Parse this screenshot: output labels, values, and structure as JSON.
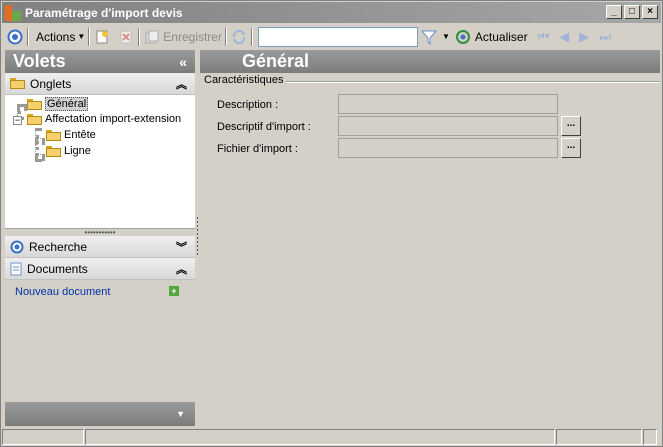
{
  "window": {
    "title": "Paramétrage d'import devis",
    "controls": {
      "minimize": "_",
      "maximize": "□",
      "close": "×"
    }
  },
  "toolbar": {
    "actions_label": "Actions",
    "save_label": "Enregistrer",
    "search_value": "",
    "refresh_label": "Actualiser",
    "icons": [
      "circle-icon",
      "new-doc-icon",
      "delete-icon",
      "save-icon",
      "sync-icon",
      "filter-icon",
      "refresh-icon",
      "first-icon",
      "prev-icon",
      "next-icon",
      "last-icon"
    ]
  },
  "left_panel": {
    "title": "Volets",
    "collapse": "«",
    "sections": {
      "onglets": {
        "label": "Onglets",
        "chevron": "⌃"
      },
      "recherche": {
        "label": "Recherche",
        "chevron": "⌄"
      },
      "documents": {
        "label": "Documents",
        "chevron": "⌃"
      }
    },
    "tree": {
      "general": "Général",
      "affectation": "Affectation import-extension",
      "entete": "Entête",
      "ligne": "Ligne"
    },
    "new_document": "Nouveau document"
  },
  "main": {
    "header": "Général",
    "group_title": "Caractéristiques",
    "fields": {
      "description": {
        "label": "Description :",
        "value": ""
      },
      "descriptif_import": {
        "label": "Descriptif d'import :",
        "value": "",
        "button": "..."
      },
      "fichier_import": {
        "label": "Fichier d'import :",
        "value": "",
        "button": "..."
      }
    }
  },
  "colors": {
    "header_gradient_top": "#9a9a9a",
    "header_gradient_bottom": "#7c7c7c",
    "link": "#0033aa",
    "face": "#d4d0c8"
  }
}
